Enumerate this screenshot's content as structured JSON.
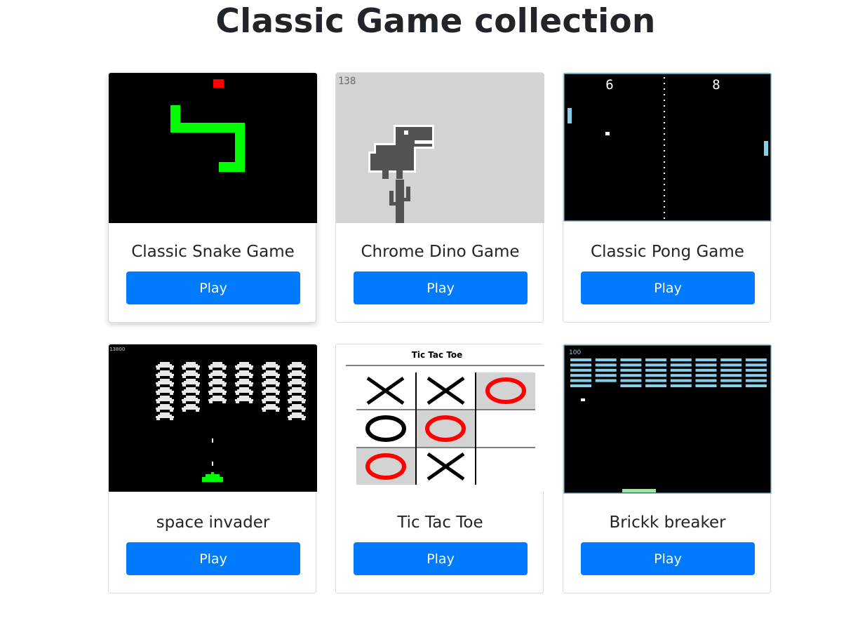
{
  "page": {
    "title": "Classic Game collection"
  },
  "games": [
    {
      "title": "Classic Snake Game",
      "button": "Play"
    },
    {
      "title": "Chrome Dino Game",
      "button": "Play",
      "thumb_score": "138"
    },
    {
      "title": "Classic Pong Game",
      "button": "Play",
      "thumb_score_left": "6",
      "thumb_score_right": "8"
    },
    {
      "title": "space invader",
      "button": "Play",
      "thumb_score": "13800"
    },
    {
      "title": "Tic Tac Toe",
      "button": "Play",
      "thumb_heading": "Tic Tac Toe"
    },
    {
      "title": "Brickk breaker",
      "button": "Play",
      "thumb_score": "100"
    }
  ],
  "colors": {
    "button": "#007bff",
    "snake": "#00ff00",
    "food": "#ff0000",
    "pong_paddle": "#87ceeb",
    "brick": "#87ceeb",
    "brick_paddle": "#90ee90",
    "dino_bg": "#d3d3d3"
  }
}
